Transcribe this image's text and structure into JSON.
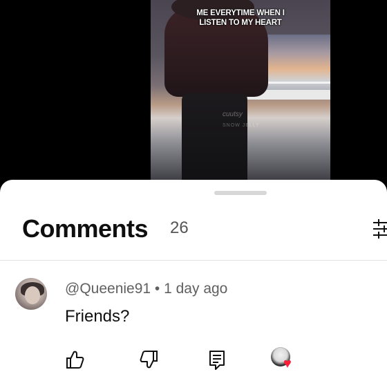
{
  "video": {
    "caption_line1": "ME EVERYTIME WHEN I",
    "caption_line2": "LISTEN TO MY HEART",
    "watermark_line1": "cuutsy",
    "watermark_line2": "SNOW JELLY"
  },
  "comments_sheet": {
    "title": "Comments",
    "count": "26",
    "filter_icon": "sort-filter-icon"
  },
  "comment": {
    "handle": "@Queenie91",
    "separator": " • ",
    "time": "1 day ago",
    "text": "Friends?",
    "avatar_icon": "user-avatar",
    "actions": {
      "like_icon": "thumbs-up-icon",
      "dislike_icon": "thumbs-down-icon",
      "reply_icon": "reply-comment-icon",
      "creator_heart_icon": "creator-heart-icon"
    }
  },
  "colors": {
    "heart": "#ff1d3a",
    "text_primary": "#0f0f0f",
    "text_secondary": "#606060"
  }
}
